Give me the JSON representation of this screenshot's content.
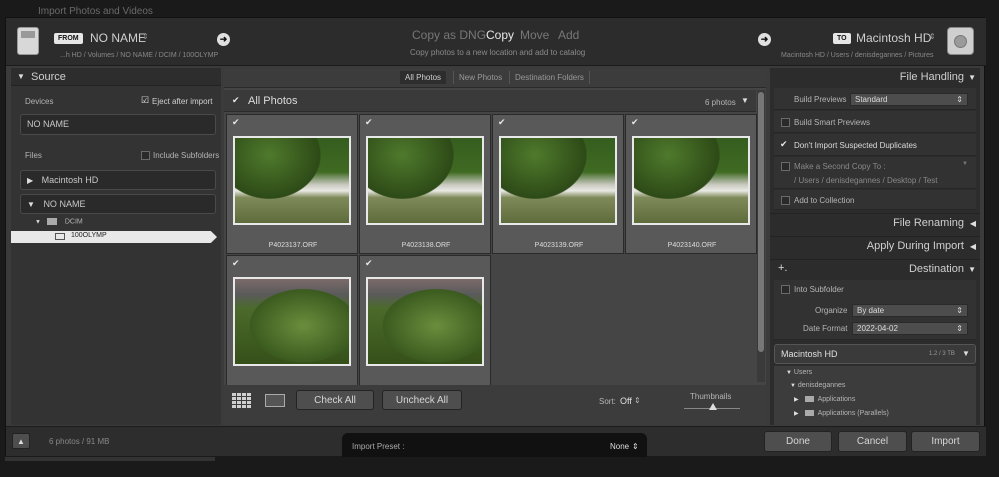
{
  "window": {
    "title": "Import Photos and Videos"
  },
  "from": {
    "tag": "FROM",
    "device": "NO NAME",
    "path": "...h HD / Volumes / NO NAME / DCIM / 100OLYMP"
  },
  "to": {
    "tag": "TO",
    "device": "Macintosh HD",
    "path": "Macintosh HD / Users / denisdegannes / Pictures"
  },
  "modes": {
    "items": [
      "Copy as DNG",
      "Copy",
      "Move",
      "Add"
    ],
    "active": "Copy",
    "description": "Copy photos to a new location and add to catalog"
  },
  "source": {
    "title": "Source",
    "devices_label": "Devices",
    "eject_label": "Eject after import",
    "device_name": "NO NAME",
    "files_label": "Files",
    "include_subfolders_label": "Include Subfolders",
    "volumes": [
      "Macintosh HD",
      "NO NAME"
    ],
    "tree": {
      "dcim": "DCIM",
      "folder": "100OLYMP"
    }
  },
  "view_tabs": {
    "items": [
      "All Photos",
      "New Photos",
      "Destination Folders"
    ],
    "active": "All Photos"
  },
  "grid": {
    "title": "All Photos",
    "count": "6 photos",
    "photos": [
      {
        "name": "P4023137.ORF"
      },
      {
        "name": "P4023138.ORF"
      },
      {
        "name": "P4023139.ORF"
      },
      {
        "name": "P4023140.ORF"
      },
      {
        "name": ""
      },
      {
        "name": ""
      }
    ]
  },
  "toolbar": {
    "check_all": "Check All",
    "uncheck_all": "Uncheck All",
    "sort_label": "Sort:",
    "sort_value": "Off",
    "thumbnails_label": "Thumbnails"
  },
  "file_handling": {
    "title": "File Handling",
    "build_previews_label": "Build Previews",
    "build_previews_value": "Standard",
    "smart_previews": "Build Smart Previews",
    "no_duplicates": "Don't Import Suspected Duplicates",
    "second_copy": "Make a Second Copy To :",
    "second_copy_path": "/ Users / denisdegannes / Desktop / Test",
    "add_collection": "Add to Collection"
  },
  "file_renaming": {
    "title": "File Renaming"
  },
  "apply_during_import": {
    "title": "Apply During Import"
  },
  "destination": {
    "title": "Destination",
    "plus": "+.",
    "into_subfolder": "Into Subfolder",
    "organize_label": "Organize",
    "organize_value": "By date",
    "date_format_label": "Date Format",
    "date_format_value": "2022-04-02",
    "volume": "Macintosh HD",
    "volume_usage": "1.2 / 3 TB",
    "tree": [
      "Users",
      "denisdegannes",
      "Applications",
      "Applications (Parallels)"
    ]
  },
  "footer": {
    "summary": "6 photos / 91 MB",
    "preset_label": "Import Preset :",
    "preset_value": "None",
    "done": "Done",
    "cancel": "Cancel",
    "import": "Import"
  }
}
